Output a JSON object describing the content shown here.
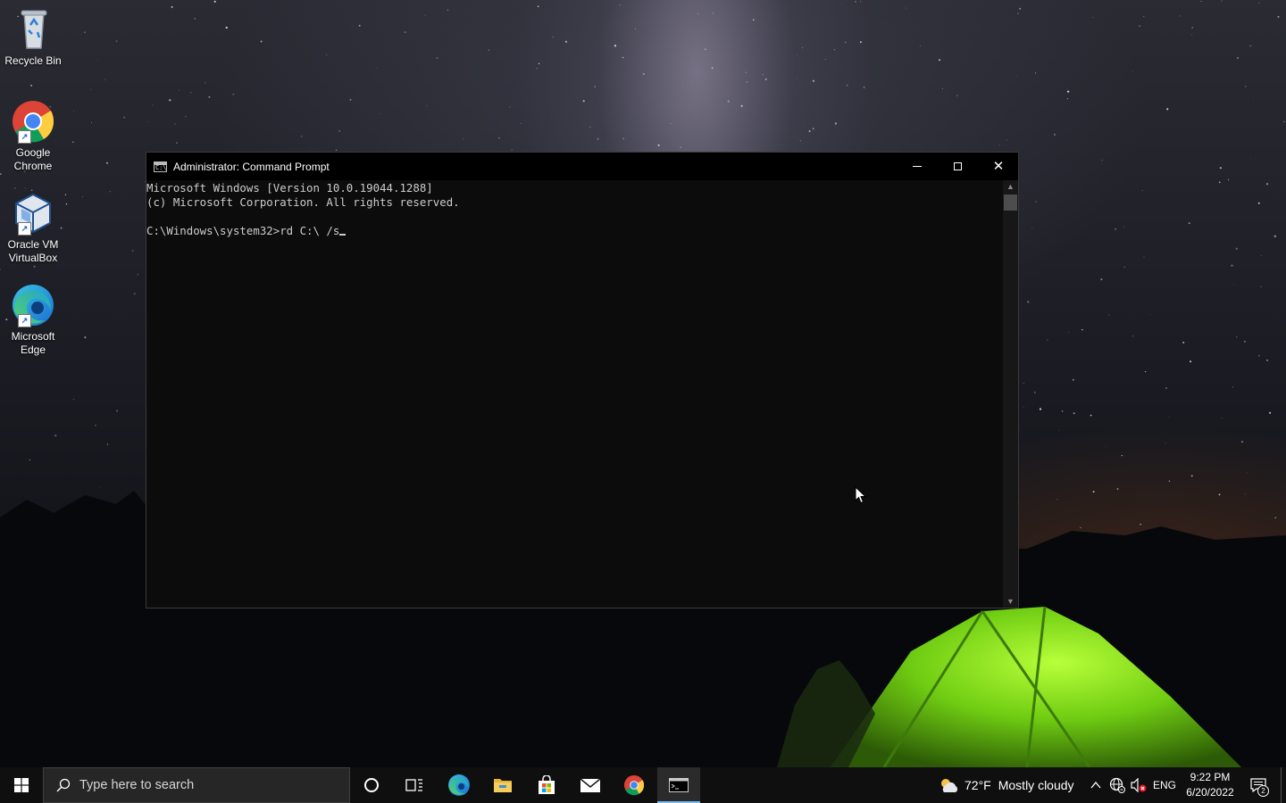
{
  "desktop": {
    "icons": [
      {
        "label": "Recycle Bin",
        "icon": "recycle-bin-icon"
      },
      {
        "label": "Google Chrome",
        "icon": "chrome-icon"
      },
      {
        "label": "Oracle VM VirtualBox",
        "icon": "virtualbox-icon"
      },
      {
        "label": "Microsoft Edge",
        "icon": "edge-icon"
      }
    ],
    "icon_lines": {
      "recycle_bin": [
        "Recycle Bin"
      ],
      "chrome": [
        "Google",
        "Chrome"
      ],
      "virtualbox": [
        "Oracle VM",
        "VirtualBox"
      ],
      "edge": [
        "Microsoft",
        "Edge"
      ]
    }
  },
  "window": {
    "title": "Administrator: Command Prompt",
    "icon_glyph": "C:\\",
    "console_lines": [
      "Microsoft Windows [Version 10.0.19044.1288]",
      "(c) Microsoft Corporation. All rights reserved.",
      "",
      "C:\\Windows\\system32>rd C:\\ /s"
    ],
    "colors": {
      "background": "#0c0c0c",
      "text": "#cccccc"
    }
  },
  "taskbar": {
    "search_placeholder": "Type here to search",
    "pinned": [
      "cortana-icon",
      "task-view-icon",
      "edge-icon",
      "file-explorer-icon",
      "microsoft-store-icon",
      "mail-icon",
      "chrome-icon",
      "command-prompt-icon"
    ],
    "active_app": "command-prompt-icon",
    "weather": {
      "temp": "72°F",
      "description": "Mostly cloudy",
      "icon": "partly-cloudy-icon"
    },
    "tray": {
      "language": "ENG",
      "chevron": "^"
    },
    "clock": {
      "time": "9:22 PM",
      "date": "6/20/2022"
    },
    "notification_count": "2",
    "accent": "#76b9ed"
  }
}
